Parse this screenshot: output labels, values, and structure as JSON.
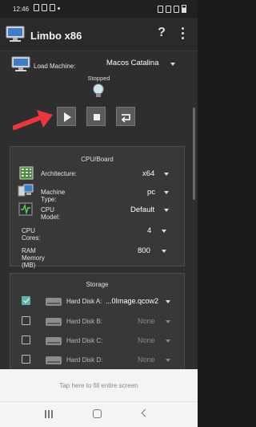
{
  "status_bar": {
    "time": "12:46"
  },
  "app": {
    "title": "Limbo x86",
    "help_label": "?"
  },
  "machine": {
    "label": "Load Machine:",
    "value": "Macos Catalina",
    "status": "Stopped"
  },
  "cpu_board": {
    "title": "CPU/Board",
    "rows": [
      {
        "label": "Architecture:",
        "value": "x64"
      },
      {
        "label": "Machine Type:",
        "value": "pc"
      },
      {
        "label": "CPU Model:",
        "value": "Default"
      },
      {
        "label": "CPU Cores:",
        "value": "4"
      },
      {
        "label": "RAM Memory (MB)",
        "value": "800"
      }
    ]
  },
  "storage": {
    "title": "Storage",
    "disks": [
      {
        "label": "Hard Disk A:",
        "value": "...0Image.qcow2",
        "checked": true
      },
      {
        "label": "Hard Disk B:",
        "value": "None",
        "checked": false
      },
      {
        "label": "Hard Disk C:",
        "value": "None",
        "checked": false
      },
      {
        "label": "Hard Disk D:",
        "value": "None",
        "checked": false
      }
    ]
  },
  "fullscreen_hint": "Tap here to fill entire screen",
  "colors": {
    "accent": "#5fb2b2",
    "arrow": "#e8383d",
    "background": "#2e2e2e",
    "panel": "#383838"
  },
  "icons": [
    "computer-icon",
    "lightbulb-icon",
    "play-icon",
    "stop-icon",
    "restart-icon",
    "chip-icon",
    "machine-icon",
    "monitor-icon",
    "hard-disk-icon",
    "help-icon",
    "more-vert-icon"
  ]
}
